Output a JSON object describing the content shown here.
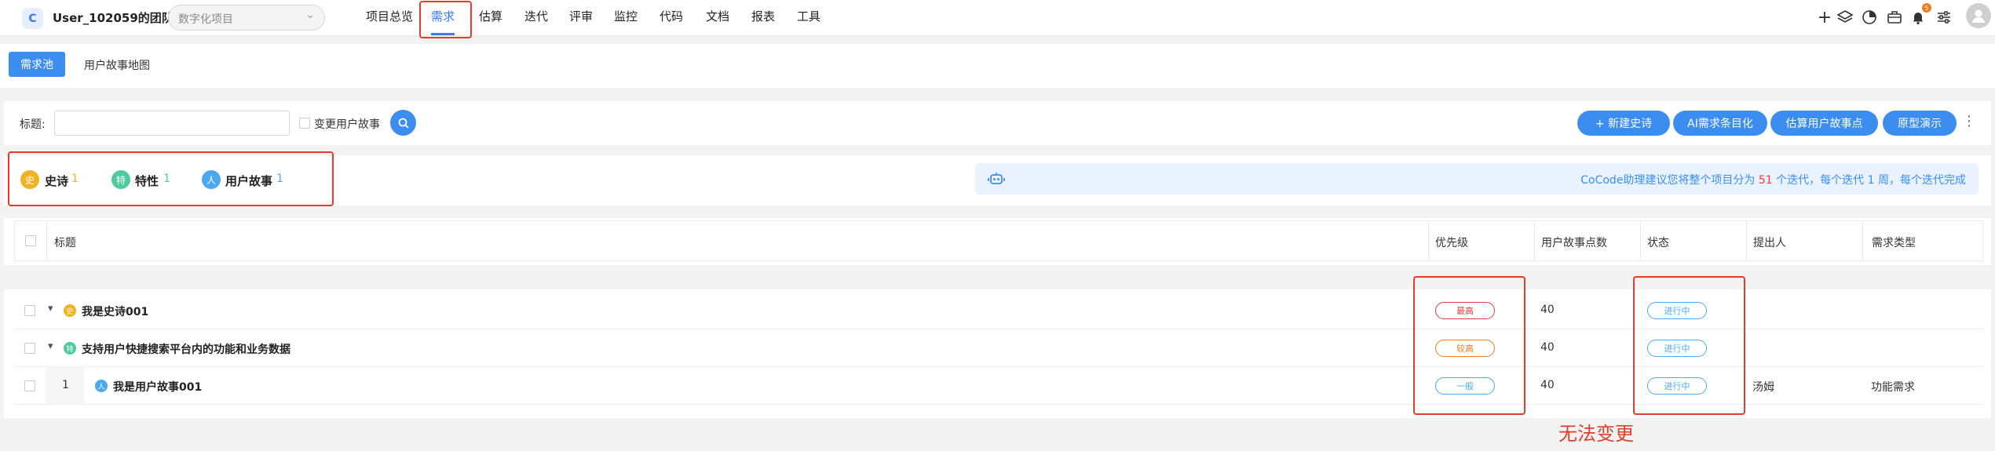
{
  "header": {
    "logo_text": "C",
    "team": "User_102059的团队",
    "project_placeholder": "数字化项目",
    "nav": [
      "项目总览",
      "需求",
      "估算",
      "迭代",
      "评审",
      "监控",
      "代码",
      "文档",
      "报表",
      "工具"
    ],
    "active_nav": "需求",
    "icons": [
      "plus-icon",
      "layers-icon",
      "pie-chart-icon",
      "briefcase-icon",
      "bell-icon",
      "settings-sliders-icon",
      "user-avatar-icon"
    ],
    "bell_badge": "5"
  },
  "subtabs": {
    "primary": "需求池",
    "secondary": "用户故事地图"
  },
  "filter": {
    "title_label": "标题:",
    "title_value": "",
    "change_story_label": "变更用户故事",
    "buttons": [
      "+ 新建史诗",
      "AI需求条目化",
      "估算用户故事点",
      "原型演示"
    ],
    "more": "⋮"
  },
  "stats": [
    {
      "icon_text": "史",
      "label": "史诗",
      "count": "1",
      "color": "#f0b323"
    },
    {
      "icon_text": "特",
      "label": "特性",
      "count": "1",
      "color": "#4ecb9d"
    },
    {
      "icon_text": "人",
      "label": "用户故事",
      "count": "1",
      "color": "#4aa8f0"
    }
  ],
  "assistant": {
    "prefix": "CoCode助理建议您将整个项目分为",
    "iterations": "51",
    "mid": "个迭代，每个迭代",
    "weeks": "1",
    "suffix": "周，每个迭代完成"
  },
  "table": {
    "headers": {
      "title": "标题",
      "priority": "优先级",
      "points": "用户故事点数",
      "status": "状态",
      "proposer": "提出人",
      "type": "需求类型"
    },
    "rows": [
      {
        "index": "",
        "icon_text": "史",
        "title": "我是史诗001",
        "priority": "最高",
        "points": "40",
        "status": "进行中",
        "proposer": "",
        "type": ""
      },
      {
        "index": "",
        "icon_text": "特",
        "title": "支持用户快捷搜索平台内的功能和业务数据",
        "priority": "较高",
        "points": "40",
        "status": "进行中",
        "proposer": "",
        "type": ""
      },
      {
        "index": "1",
        "icon_text": "人",
        "title": "我是用户故事001",
        "priority": "一般",
        "points": "40",
        "status": "进行中",
        "proposer": "汤姆",
        "type": "功能需求"
      }
    ]
  },
  "annotation": "无法变更",
  "colors": {
    "accent": "#3b8ef0",
    "priority_highest": "#e33d3d",
    "priority_high": "#f07c20",
    "priority_normal": "#4aa8f0",
    "status": "#4aa8f0",
    "annotation": "#e23d2a"
  }
}
